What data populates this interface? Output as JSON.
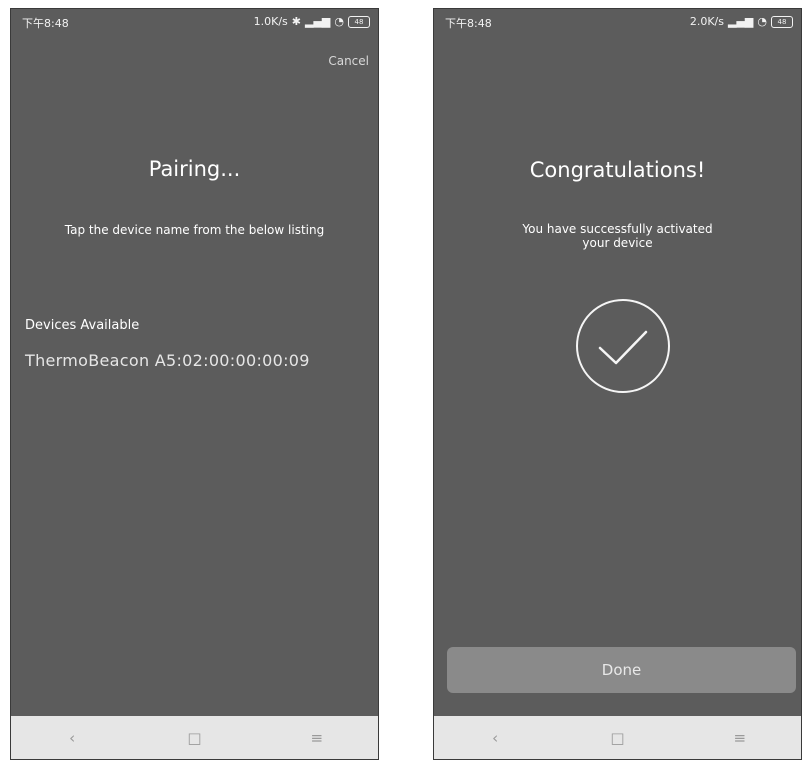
{
  "left_screen": {
    "status": {
      "time": "下午8:48",
      "net": "1.0K/s",
      "battery": "48"
    },
    "cancel_label": "Cancel",
    "title": "Pairing...",
    "subtitle": "Tap the device name from the below listing",
    "devices_label": "Devices Available",
    "devices": [
      "ThermoBeacon A5:02:00:00:00:09"
    ],
    "nav": {
      "back": "‹",
      "home": "□",
      "menu": "≡"
    }
  },
  "right_screen": {
    "status": {
      "time": "下午8:48",
      "net": "2.0K/s",
      "battery": "48"
    },
    "title": "Congratulations!",
    "subtitle_line1": "You have successfully activated",
    "subtitle_line2": "your device",
    "done_label": "Done",
    "nav": {
      "back": "‹",
      "home": "□",
      "menu": "≡"
    }
  }
}
